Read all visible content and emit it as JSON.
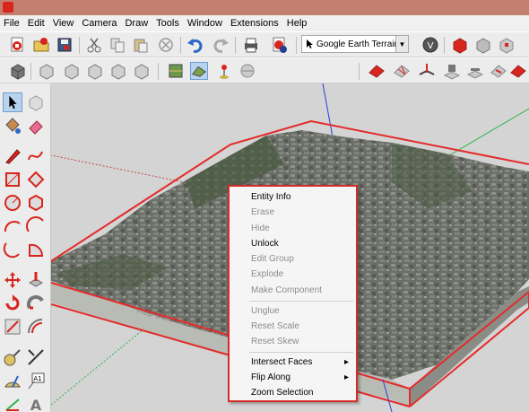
{
  "menubar": {
    "items": [
      "File",
      "Edit",
      "View",
      "Camera",
      "Draw",
      "Tools",
      "Window",
      "Extensions",
      "Help"
    ]
  },
  "toolbar": {
    "location_dropdown_value": "Google Earth Terrain"
  },
  "context_menu": {
    "items": [
      {
        "label": "Entity Info",
        "enabled": true
      },
      {
        "label": "Erase",
        "enabled": false
      },
      {
        "label": "Hide",
        "enabled": false
      },
      {
        "label": "Unlock",
        "enabled": true
      },
      {
        "label": "Edit Group",
        "enabled": false
      },
      {
        "label": "Explode",
        "enabled": false
      },
      {
        "label": "Make Component",
        "enabled": false
      },
      {
        "label": "Unglue",
        "enabled": false
      },
      {
        "label": "Reset Scale",
        "enabled": false
      },
      {
        "label": "Reset Skew",
        "enabled": false
      },
      {
        "label": "Intersect Faces",
        "enabled": true,
        "submenu": true
      },
      {
        "label": "Flip Along",
        "enabled": true,
        "submenu": true
      },
      {
        "label": "Zoom Selection",
        "enabled": true
      }
    ],
    "submenu_arrow": "▸"
  },
  "viewport": {
    "terrain_footer_text": "Map Data  Terms of Use  Map error"
  },
  "colors": {
    "selection_outline": "#e32b2b",
    "blue_axis": "#2a3ed6",
    "green_axis": "#2fb34a",
    "red_axis_dotted": "#c64646"
  }
}
